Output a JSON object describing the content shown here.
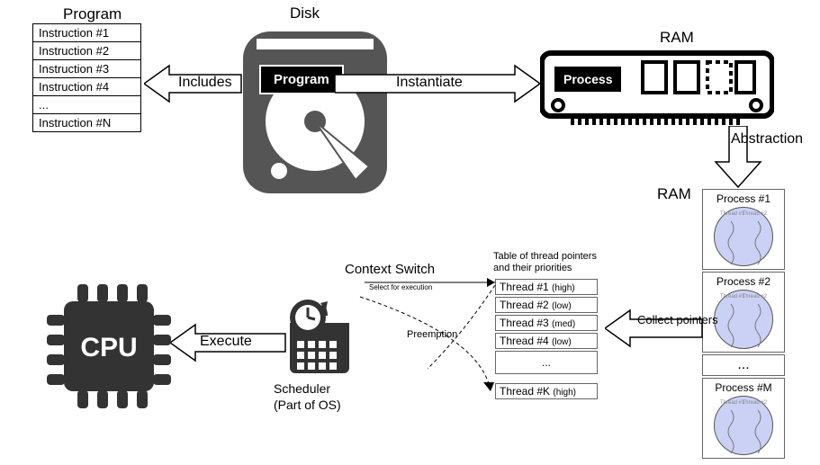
{
  "top": {
    "disk_label": "Disk",
    "program_header": "Program",
    "instructions": [
      "Instruction #1",
      "Instruction #2",
      "Instruction #3",
      "Instruction #4",
      "...",
      "Instruction #N"
    ],
    "program_chip": "Program",
    "includes": "Includes",
    "instantiate": "Instantiate",
    "ram_label": "RAM",
    "process_chip": "Process",
    "abstraction": "Abstraction"
  },
  "bottom": {
    "ram_label": "RAM",
    "processes": [
      "Process #1",
      "Process #2",
      "...",
      "Process #M"
    ],
    "proc_thread_a": "Thread #1",
    "proc_thread_b": "Thread #2",
    "collect": "Collect pointers",
    "table_caption": "Table of thread pointers and their priorities",
    "threads": [
      {
        "name": "Thread #1",
        "pri": "(high)"
      },
      {
        "name": "Thread #2",
        "pri": "(low)"
      },
      {
        "name": "Thread #3",
        "pri": "(med)"
      },
      {
        "name": "Thread #4",
        "pri": "(low)"
      },
      {
        "name": "...",
        "pri": ""
      },
      {
        "name": "Thread #K",
        "pri": "(high)"
      }
    ],
    "context_switch": "Context Switch",
    "select": "Select for execution",
    "preemption": "Preemption",
    "scheduler_l1": "Scheduler",
    "scheduler_l2": "(Part of OS)",
    "execute": "Execute",
    "cpu": "CPU"
  }
}
